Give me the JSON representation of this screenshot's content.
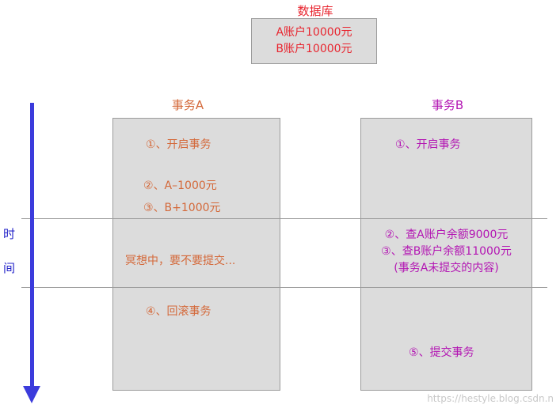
{
  "database": {
    "title": "数据库",
    "lines": [
      "A账户10000元",
      "B账户10000元"
    ]
  },
  "transaction_a": {
    "title": "事务A",
    "steps": [
      "①、开启事务",
      "②、A–1000元",
      "③、B+1000元",
      "冥想中，要不要提交...",
      "④、回滚事务"
    ]
  },
  "transaction_b": {
    "title": "事务B",
    "steps": [
      "①、开启事务",
      "②、查A账户余额9000元",
      "③、查B账户余额11000元",
      "(事务A未提交的内容)",
      "⑤、提交事务"
    ]
  },
  "time_axis": {
    "chars": [
      "时",
      "间"
    ]
  },
  "watermark": "https://hestyle.blog.csdn.n",
  "colors": {
    "database": "#e8252f",
    "transaction_a": "#d4693a",
    "transaction_b": "#b316b3",
    "arrow": "#3b3bdc",
    "box_fill": "#dcdcdc"
  }
}
